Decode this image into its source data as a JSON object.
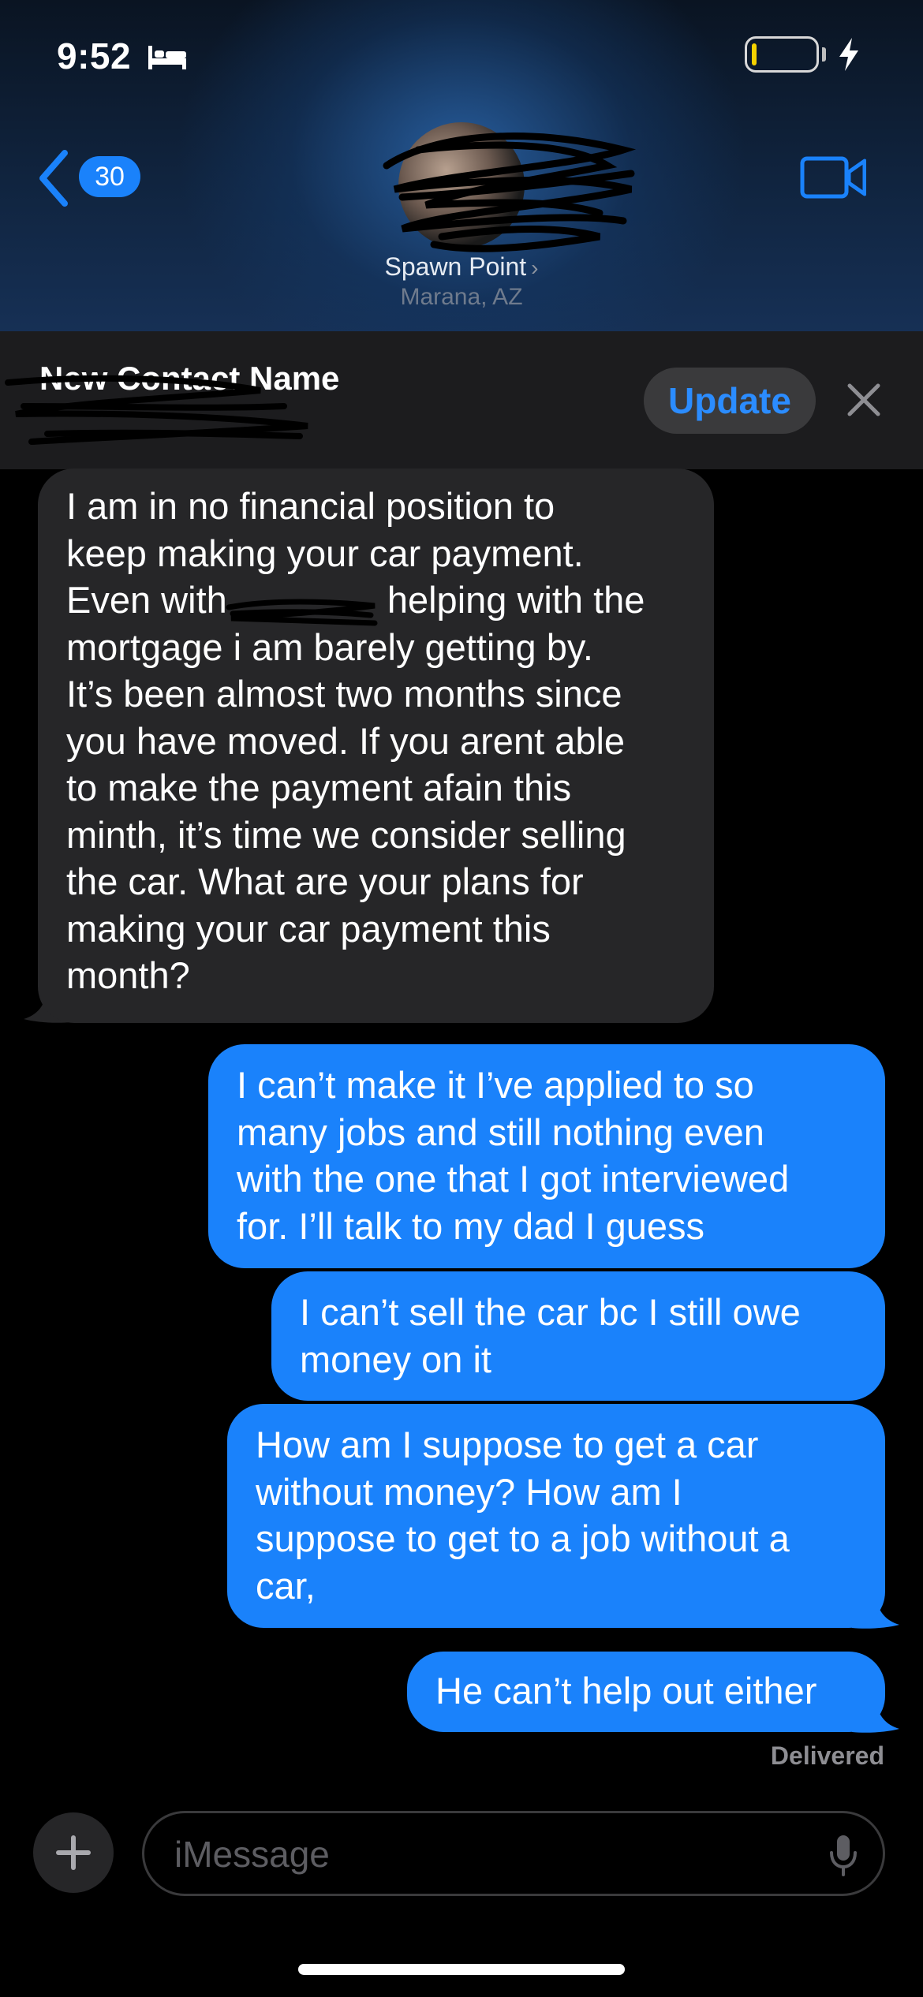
{
  "status_bar": {
    "time": "9:52",
    "sleep_icon": "bed-icon",
    "battery_level": 0.05,
    "charging": true
  },
  "nav": {
    "back_count": "30",
    "contact_name": "Spawn Point",
    "contact_location": "Marana, AZ",
    "video_icon": "video-camera-icon"
  },
  "banner": {
    "title": "New Contact Name",
    "update_label": "Update"
  },
  "messages": [
    {
      "direction": "incoming",
      "text": "I am in no financial position to keep making your car payment. Even with [redacted] helping with the mortgage i am barely getting by. It’s been almost two months since you have moved. If you arent able to make the payment afain this minth, it’s time we consider selling the car. What are your plans for making your car payment this month?"
    },
    {
      "direction": "outgoing",
      "text": "I can’t make it I’ve applied to so many jobs and still nothing even with the one that I got interviewed for. I’ll talk to my dad I guess"
    },
    {
      "direction": "outgoing",
      "text": "I can’t sell the car bc I still owe money on it"
    },
    {
      "direction": "outgoing",
      "text": "How am I suppose to get a car without money? How am I suppose to get to a job without a car,"
    },
    {
      "direction": "outgoing",
      "text": "He can’t help out either"
    }
  ],
  "incoming_lines": [
    "I am in no financial position to",
    "keep making your car payment.",
    "Even with ",
    "helping with the",
    "mortgage i am barely getting by.",
    "It’s been almost two months since",
    "you have moved. If you arent able",
    "to make the payment afain this",
    "minth, it’s time we consider selling",
    "the car. What are your plans for",
    "making your car payment this",
    "month?"
  ],
  "outgoing_lines": {
    "m1": [
      "I can’t make it I’ve applied to so",
      "many jobs and still nothing even",
      "with the one that I got interviewed",
      "for. I’ll talk to my dad I guess"
    ],
    "m2": [
      "I can’t sell the car bc I still owe",
      "money on it"
    ],
    "m3": [
      "How am I suppose to get a car",
      "without money? How am I",
      "suppose to get to a job without a",
      "car,"
    ],
    "m4": [
      "He can’t help out either"
    ]
  },
  "delivery_status": "Delivered",
  "composer": {
    "placeholder": "iMessage",
    "plus_icon": "plus-icon",
    "mic_icon": "microphone-icon"
  },
  "colors": {
    "accent": "#1a82fb",
    "incoming_bubble": "#262628",
    "background": "#000000"
  }
}
